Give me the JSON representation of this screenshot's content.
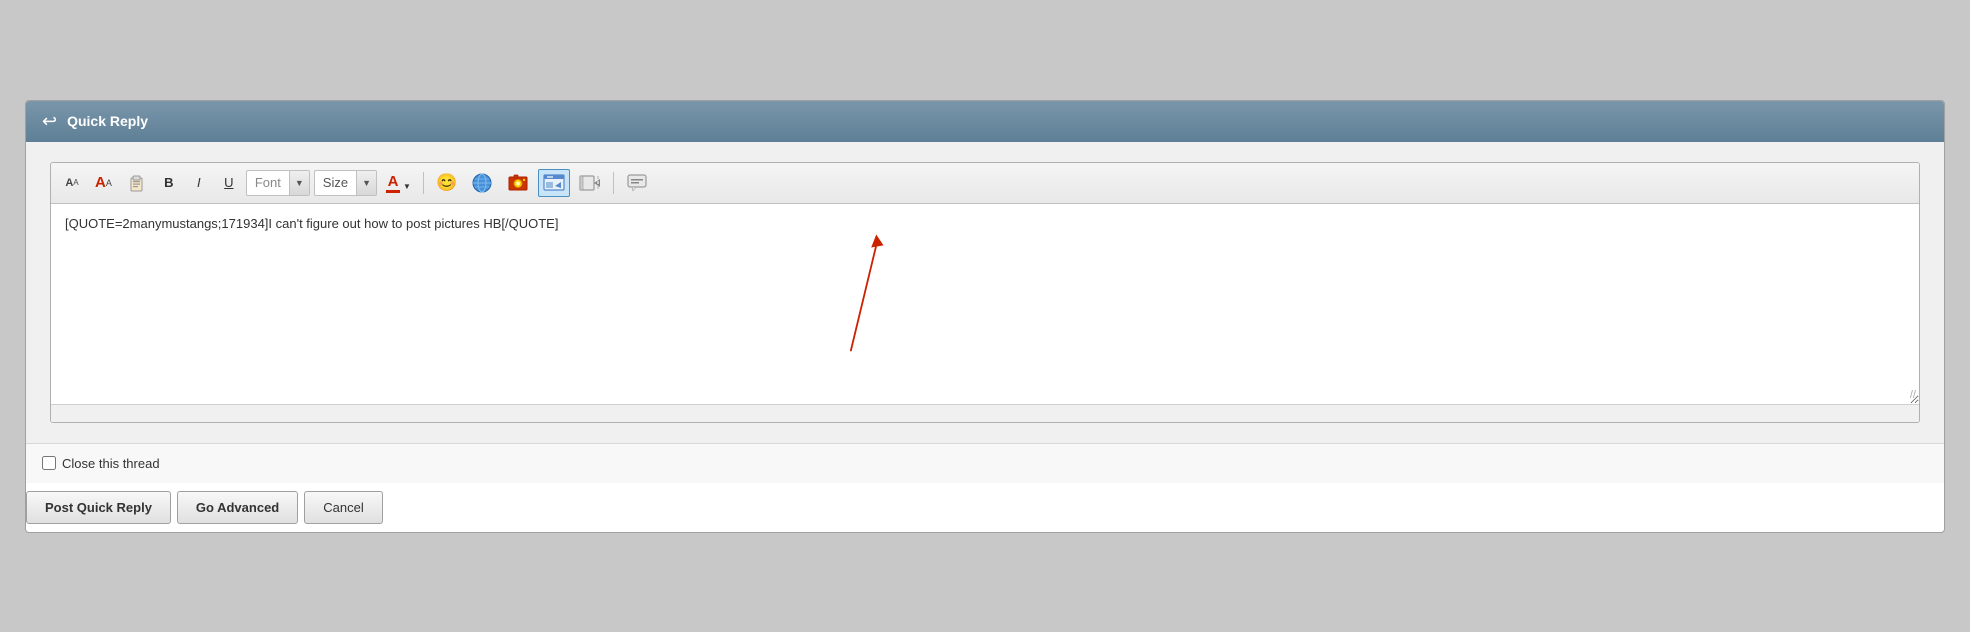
{
  "header": {
    "title": "Quick Reply",
    "back_icon": "↩"
  },
  "toolbar": {
    "font_label": "Font",
    "size_label": "Size",
    "buttons": {
      "font_size_small": "A",
      "font_size_large": "A",
      "bold": "B",
      "italic": "I",
      "underline": "U",
      "color": "A",
      "emoji": "😊",
      "insert_image_tooltip": "Insert Image",
      "insert_link_tooltip": "Insert Link",
      "smilies_tooltip": "Smilies",
      "post_image_tooltip": "Post Image",
      "quote_tooltip": "Quote"
    }
  },
  "editor": {
    "content": "[QUOTE=2manymustangs;171934]I can't figure out how to post pictures HB[/QUOTE]",
    "placeholder": ""
  },
  "footer": {
    "close_thread_label": "Close this thread"
  },
  "actions": {
    "post_quick_reply": "Post Quick Reply",
    "go_advanced": "Go Advanced",
    "cancel": "Cancel"
  }
}
